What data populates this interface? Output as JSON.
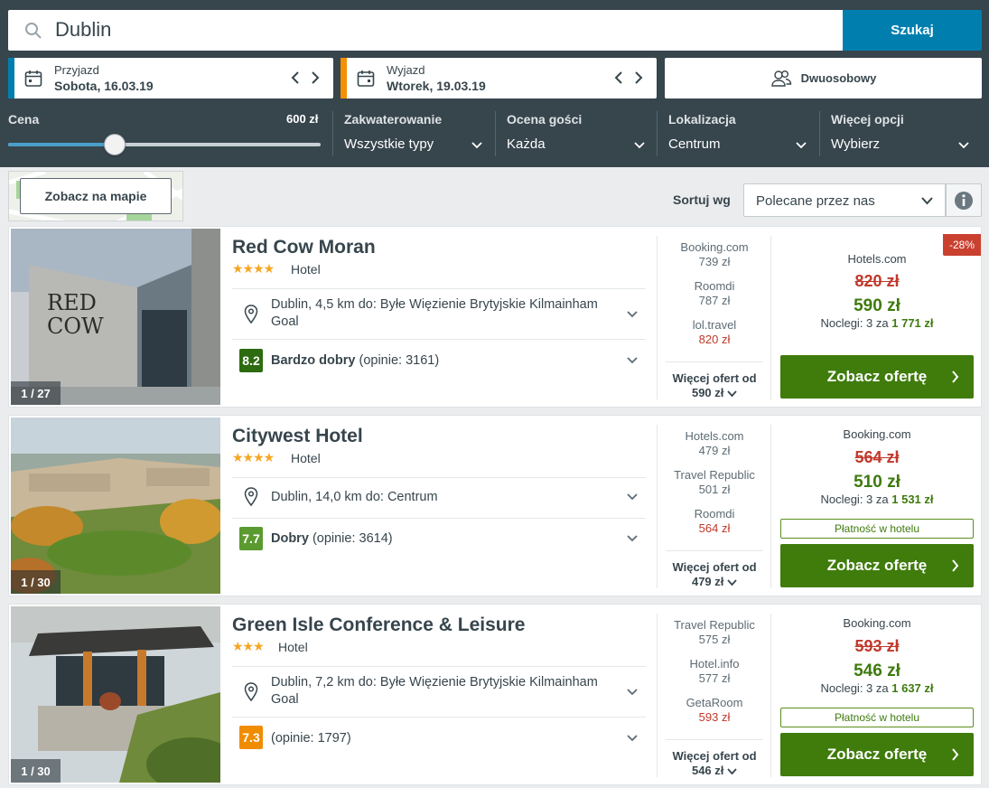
{
  "search": {
    "query": "Dublin",
    "button": "Szukaj"
  },
  "checkin": {
    "label": "Przyjazd",
    "value": "Sobota, 16.03.19",
    "accent": "#007faf"
  },
  "checkout": {
    "label": "Wyjazd",
    "value": "Wtorek, 19.03.19",
    "accent": "#f48f00"
  },
  "room": {
    "label": "Dwuosobowy",
    "icon": "users-icon"
  },
  "filters": {
    "price": {
      "label": "Cena",
      "max_label": "600 zł",
      "level_fraction": 0.34
    },
    "accommodation": {
      "label": "Zakwaterowanie",
      "value": "Wszystkie typy"
    },
    "guest_rating": {
      "label": "Ocena gości",
      "value": "Każda"
    },
    "location": {
      "label": "Lokalizacja",
      "value": "Centrum"
    },
    "more": {
      "label": "Więcej opcji",
      "value": "Wybierz"
    }
  },
  "map": {
    "button": "Zobacz na mapie"
  },
  "sort": {
    "label": "Sortuj wg",
    "value": "Polecane przez nas",
    "info_icon": "info-icon"
  },
  "colors": {
    "header": "#37454d",
    "accent_blue": "#007faf",
    "cta_green": "#3f7c0b",
    "price_red": "#c0392b"
  },
  "hotels": [
    {
      "name": "Red Cow Moran",
      "stars": "★★★★",
      "type": "Hotel",
      "location": "Dublin, 4,5 km do: Byłe Więzienie Brytyjskie Kilmainham Goal",
      "score": "8.2",
      "score_color": "#2d6b10",
      "rating_word": "Bardzo dobry",
      "reviews": "(opinie: 3161)",
      "photo_count": "1 / 27",
      "offers": [
        {
          "site": "Booking.com",
          "price": "739 zł",
          "red": false
        },
        {
          "site": "Roomdi",
          "price": "787 zł",
          "red": false
        },
        {
          "site": "lol.travel",
          "price": "820 zł",
          "red": true
        }
      ],
      "more_label": "Więcej ofert od",
      "more_price": "590 zł",
      "deal_site": "Hotels.com",
      "old_price": "820 zł",
      "new_price": "590 zł",
      "nights_prefix": "Noclegi: 3 za",
      "nights_total": "1 771 zł",
      "discount": "-28%",
      "pay_at_hotel": "",
      "cta": "Zobacz ofertę"
    },
    {
      "name": "Citywest Hotel",
      "stars": "★★★★",
      "type": "Hotel",
      "location": "Dublin, 14,0 km do: Centrum",
      "score": "7.7",
      "score_color": "#5b9a2f",
      "rating_word": "Dobry",
      "reviews": "(opinie: 3614)",
      "photo_count": "1 / 30",
      "offers": [
        {
          "site": "Hotels.com",
          "price": "479 zł",
          "red": false
        },
        {
          "site": "Travel Republic",
          "price": "501 zł",
          "red": false
        },
        {
          "site": "Roomdi",
          "price": "564 zł",
          "red": true
        }
      ],
      "more_label": "Więcej ofert od",
      "more_price": "479 zł",
      "deal_site": "Booking.com",
      "old_price": "564 zł",
      "new_price": "510 zł",
      "nights_prefix": "Noclegi: 3 za",
      "nights_total": "1 531 zł",
      "discount": "",
      "pay_at_hotel": "Płatność w hotelu",
      "cta": "Zobacz ofertę"
    },
    {
      "name": "Green Isle Conference & Leisure",
      "stars": "★★★",
      "type": "Hotel",
      "location": "Dublin, 7,2 km do: Byłe Więzienie Brytyjskie Kilmainham Goal",
      "score": "7.3",
      "score_color": "#f08c00",
      "rating_word": "",
      "reviews": "(opinie: 1797)",
      "photo_count": "1 / 30",
      "offers": [
        {
          "site": "Travel Republic",
          "price": "575 zł",
          "red": false
        },
        {
          "site": "Hotel.info",
          "price": "577 zł",
          "red": false
        },
        {
          "site": "GetaRoom",
          "price": "593 zł",
          "red": true
        }
      ],
      "more_label": "Więcej ofert od",
      "more_price": "546 zł",
      "deal_site": "Booking.com",
      "old_price": "593 zł",
      "new_price": "546 zł",
      "nights_prefix": "Noclegi: 3 za",
      "nights_total": "1 637 zł",
      "discount": "",
      "pay_at_hotel": "Płatność w hotelu",
      "cta": "Zobacz ofertę"
    }
  ]
}
